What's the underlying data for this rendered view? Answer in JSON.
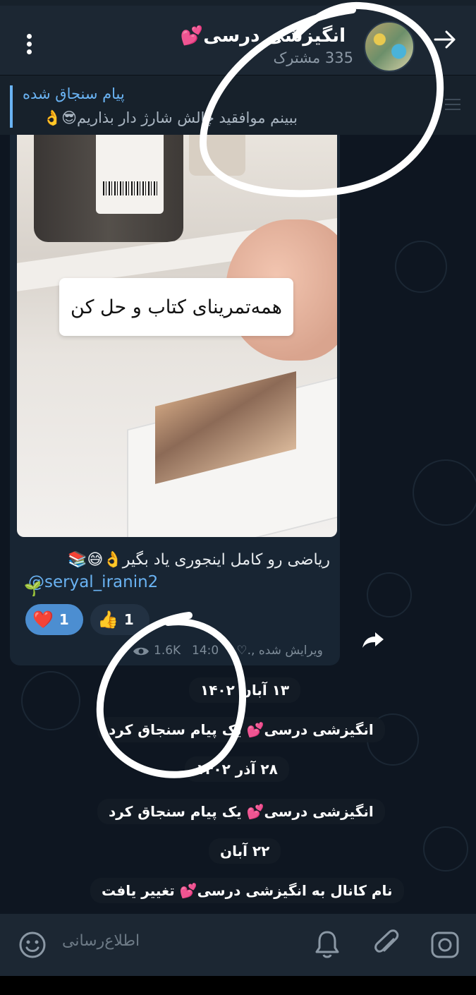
{
  "header": {
    "title": "انگیزشی درسی💕",
    "subtitle": "335 مشترک"
  },
  "pinned": {
    "title": "پیام سنجاق شده",
    "text": "ببینم موافقید چالش شارژ دار بذاریم😎👌"
  },
  "post": {
    "image_caption": "همه‌تمرینای کتاب و حل کن",
    "text": "ریاضی رو کامل اینجوری یاد بگیر👌😅📚",
    "link": "@seryal_iranin2",
    "reactions": [
      {
        "emoji": "❤️",
        "count": "1"
      },
      {
        "emoji": "👍",
        "count": "1"
      }
    ],
    "views": "1.6K",
    "time": "14:0",
    "edited": "ویرایش شده ,.♡."
  },
  "service_messages": [
    "۱۳ آبان ۱۴۰۲",
    "انگیزشی درسی💕 یک پیام سنجاق کرد",
    "۲۸ آذر ۱۴۰۲",
    "انگیزشی درسی💕 یک پیام سنجاق کرد",
    "۲۲ آبان",
    "نام کانال به انگیزشی درسی💕 تغییر یافت"
  ],
  "composer": {
    "placeholder": "اطلاع‌رسانی"
  },
  "colors": {
    "accent": "#6ab3f3",
    "reaction_active": "#4c8ed1",
    "background": "#0e1621",
    "bubble": "#182533"
  }
}
